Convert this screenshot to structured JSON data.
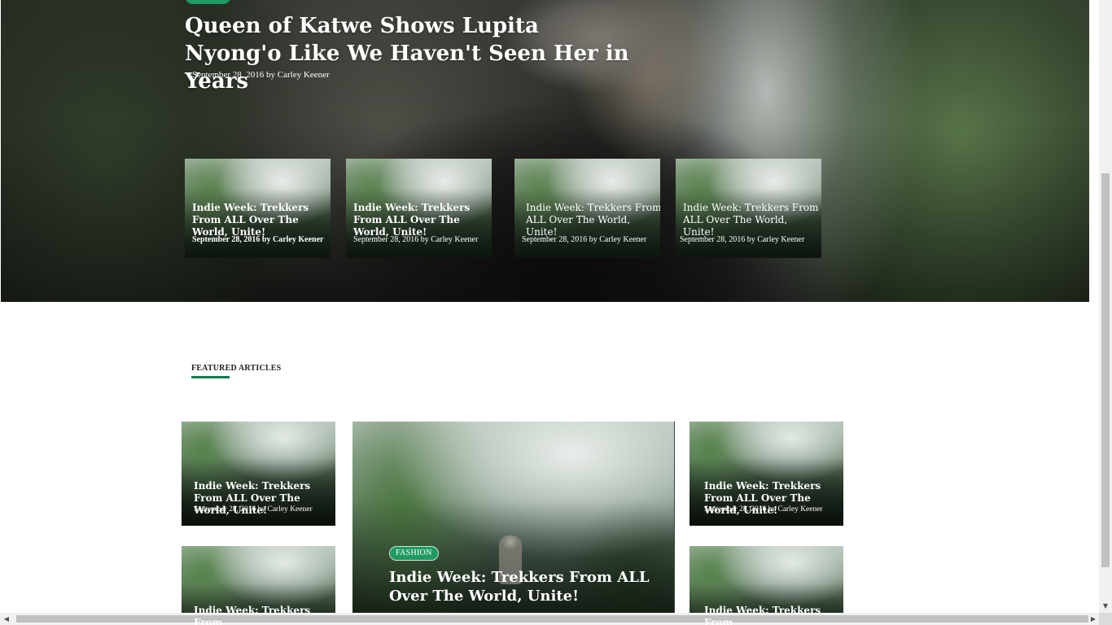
{
  "hero": {
    "title": "Queen of Katwe Shows Lupita Nyong'o Like We Haven't Seen Her in Years",
    "meta": "September 28, 2016 by Carley Keener",
    "cards": [
      {
        "title": "Indie Week: Trekkers From ALL Over The World, Unite!",
        "meta": "September 28, 2016 by Carley Keener"
      },
      {
        "title": "Indie Week: Trekkers From ALL Over The World, Unite!",
        "meta": "September 28, 2016 by Carley Keener"
      },
      {
        "title": "Indie Week: Trekkers From ALL Over The World, Unite!",
        "meta": "September 28, 2016 by Carley Keener"
      },
      {
        "title": "Indie Week: Trekkers From ALL Over The World, Unite!",
        "meta": "September 28, 2016 by Carley Keener"
      }
    ]
  },
  "featured": {
    "heading": "FEATURED ARTICLES",
    "side_cards": [
      {
        "title": "Indie Week: Trekkers From ALL Over The World, Unite!",
        "meta": "September 28, 2016 by Carley Keener"
      },
      {
        "title": "Indie Week: Trekkers From ALL Over The World, Unite!",
        "meta": "September 28, 2016 by Carley Keener"
      },
      {
        "title": "Indie Week: Trekkers From",
        "meta": ""
      },
      {
        "title": "Indie Week: Trekkers From",
        "meta": ""
      }
    ],
    "main": {
      "category": "FASHION",
      "title": "Indie Week: Trekkers From ALL Over The World, Unite!"
    }
  },
  "colors": {
    "accent": "#1f9a63",
    "underline": "#177a50"
  },
  "icons": {
    "scroll_down": "chevron-down-icon",
    "scroll_left": "chevron-left-icon",
    "scroll_right": "chevron-right-icon"
  }
}
